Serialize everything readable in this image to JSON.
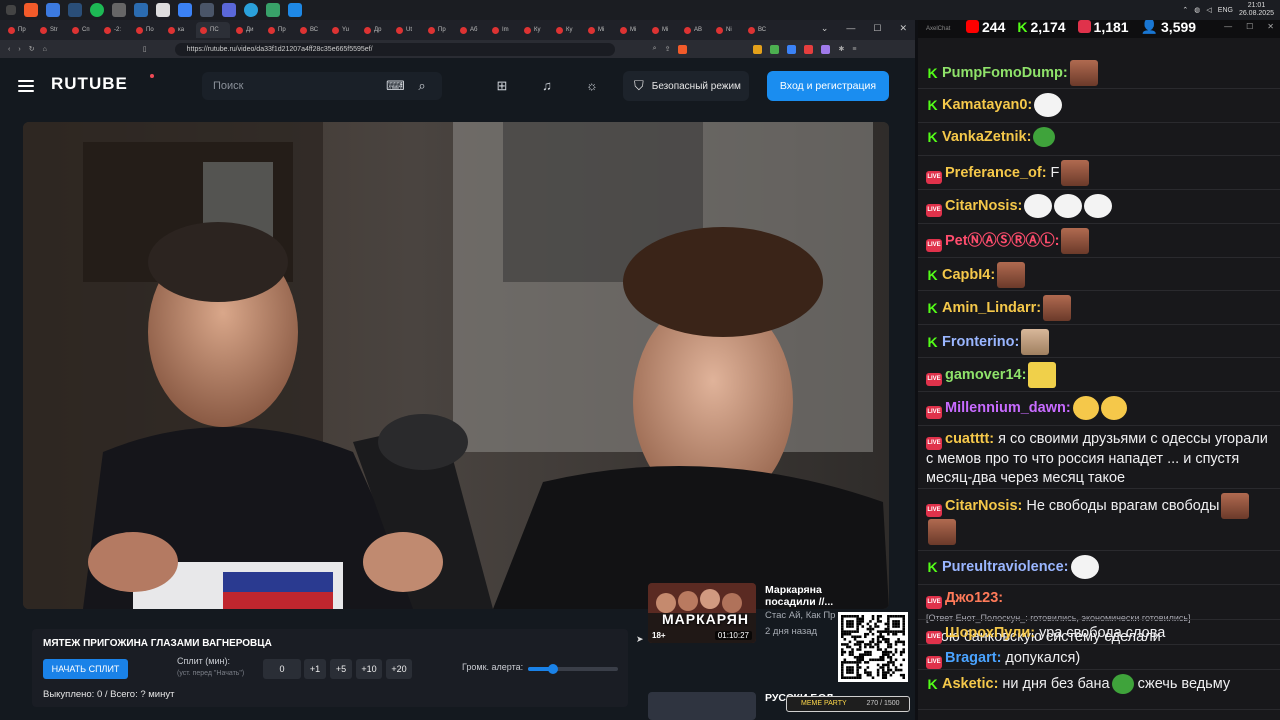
{
  "browser": {
    "url": "https://rutube.ru/video/da33f1d21207a4ff28c35e665f5595ef/",
    "tabs": [
      "Пр",
      "Str",
      "Сп",
      "-2:",
      "По",
      "ка",
      "ПС",
      "Ди",
      "Пр",
      "ВС",
      "Yu",
      "Др",
      "Ut",
      "Пр",
      "Аб",
      "Im",
      "Ку",
      "Ку",
      "Mi",
      "Mi",
      "Mi",
      "АВ",
      "Ni",
      "ВС"
    ]
  },
  "system": {
    "time": "21:01",
    "date": "26.08.2025",
    "lang": "ENG"
  },
  "rutube": {
    "logo": "RUTUBE",
    "search_placeholder": "Поиск",
    "safe_mode_label": "Безопасный режим",
    "login_label": "Вход и регистрация"
  },
  "panel": {
    "title": "МЯТЕЖ ПРИГОЖИНА ГЛАЗАМИ ВАГНЕРОВЦА",
    "start_split": "НАЧАТЬ СПЛИТ",
    "split_label": "Сплит (мин):",
    "split_hint": "(уст. перед \"Начать\")",
    "split_value": "0",
    "inc1": "+1",
    "inc5": "+5",
    "inc10": "+10",
    "inc20": "+20",
    "volume_label": "Громк. алерта:",
    "volume_level": 0.28,
    "stats": "Выкуплено: 0 / Всего: ? минут"
  },
  "recommendation": {
    "title": "Маркаряна посадили //...",
    "channel": "Стас Ай, Как Пр",
    "date": "2 дня назад",
    "age": "18+",
    "duration": "01:10:27",
    "overlay_text": "МАРКАРЯН",
    "second_title": "РУССКИ БОЛ"
  },
  "meme_bar": {
    "label": "MEME PARTY",
    "counter": "270 / 1500"
  },
  "chat": {
    "app_title": "AxelChat",
    "stats": {
      "kick": "2,174",
      "youtube": "244",
      "vk": "1,181",
      "viewers": "3,599"
    },
    "messages": [
      {
        "platform": "kick",
        "name": "PumpFomoDump:",
        "color": "#8fe26a",
        "text": "",
        "emotes": [
          "face"
        ]
      },
      {
        "platform": "kick",
        "name": "Kamatayan0:",
        "color": "#f5c84a",
        "text": "",
        "emotes": [
          "troll"
        ]
      },
      {
        "platform": "kick",
        "name": "VankaZetnik:",
        "color": "#f5c84a",
        "text": "",
        "emotes": [
          "pepe"
        ]
      },
      {
        "platform": "live",
        "name": "Preferance_of:",
        "color": "#f5c84a",
        "text": "F",
        "emotes": [
          "face"
        ]
      },
      {
        "platform": "live",
        "name": "CitarNosis:",
        "color": "#f5c84a",
        "text": "",
        "emotes": [
          "troll",
          "troll",
          "troll"
        ]
      },
      {
        "platform": "live",
        "name": "PetⓃⒶⓈⓇⒶⓁ:",
        "color": "#ff4d6d",
        "text": "",
        "emotes": [
          "face"
        ]
      },
      {
        "platform": "kick",
        "name": "CapbI4:",
        "color": "#f5c84a",
        "text": "",
        "emotes": [
          "face"
        ]
      },
      {
        "platform": "kick",
        "name": "Amin_Lindarr:",
        "color": "#f5c84a",
        "text": "",
        "emotes": [
          "face"
        ]
      },
      {
        "platform": "kick",
        "name": "Fronterino:",
        "color": "#9ab6ff",
        "text": "",
        "emotes": [
          "cat"
        ]
      },
      {
        "platform": "live",
        "name": "gamover14:",
        "color": "#8fe26a",
        "text": "",
        "emotes": [
          "yellow"
        ]
      },
      {
        "platform": "live",
        "name": "Millennium_dawn:",
        "color": "#c86bff",
        "text": "",
        "emotes": [
          "laugh",
          "laugh"
        ]
      },
      {
        "platform": "live",
        "name": "cuatttt:",
        "color": "#f5c84a",
        "text": "я со своими друзьями с одессы угорали с мемов про то что россия нападет ... и спустя месяц-два через месяц такое",
        "emotes": []
      },
      {
        "platform": "live",
        "name": "CitarNosis:",
        "color": "#f5c84a",
        "text": "Не свободы врагам свободы",
        "emotes": [
          "face",
          "face"
        ]
      },
      {
        "platform": "kick",
        "name": "Pureultraviolence:",
        "color": "#9ab6ff",
        "text": "",
        "emotes": [
          "troll"
        ]
      },
      {
        "platform": "live",
        "name": "Джо123:",
        "color": "#ff7a59",
        "reply": "[Ответ Енот_Полоскун_: готовились, экономически готовились]",
        "text": "свою банковскую систему сделали",
        "emotes": []
      },
      {
        "platform": "live",
        "name": "ШорохПули:",
        "color": "#f5c84a",
        "text": "ура свобода слова",
        "emotes": []
      },
      {
        "platform": "live",
        "name": "Bragart:",
        "color": "#4aa3ff",
        "text": "допукался)",
        "emotes": []
      },
      {
        "platform": "kick",
        "name": "Asketic:",
        "color": "#f5c84a",
        "text": "ни дня без бана",
        "text2": "сжечь ведьму",
        "emotes": [
          "pepe"
        ]
      }
    ]
  }
}
